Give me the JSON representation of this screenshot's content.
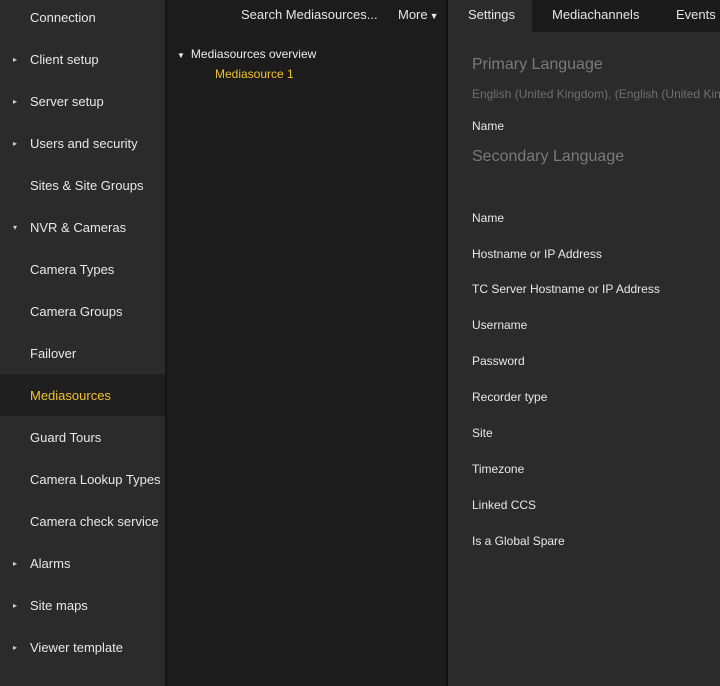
{
  "sidebar": {
    "items": [
      {
        "label": "Connection",
        "arrow": ""
      },
      {
        "label": "Client setup",
        "arrow": "▸"
      },
      {
        "label": "Server setup",
        "arrow": "▸"
      },
      {
        "label": "Users and security",
        "arrow": "▸"
      },
      {
        "label": "Sites & Site Groups",
        "arrow": ""
      },
      {
        "label": "NVR & Cameras",
        "arrow": "▾"
      },
      {
        "label": "Camera Types",
        "arrow": ""
      },
      {
        "label": "Camera Groups",
        "arrow": ""
      },
      {
        "label": "Failover",
        "arrow": ""
      },
      {
        "label": "Mediasources",
        "arrow": "",
        "active": true
      },
      {
        "label": "Guard Tours",
        "arrow": ""
      },
      {
        "label": "Camera Lookup Types",
        "arrow": ""
      },
      {
        "label": "Camera check service",
        "arrow": ""
      },
      {
        "label": "Alarms",
        "arrow": "▸"
      },
      {
        "label": "Site maps",
        "arrow": "▸"
      },
      {
        "label": "Viewer template",
        "arrow": "▸"
      }
    ]
  },
  "middle": {
    "search_label": "Search Mediasources...",
    "more_label": "More",
    "tree": {
      "root_label": "Mediasources overview",
      "child_label": "Mediasource 1"
    }
  },
  "right": {
    "tabs": [
      {
        "label": "Settings",
        "active": true
      },
      {
        "label": "Mediachannels"
      },
      {
        "label": "Events"
      }
    ],
    "primary_language": {
      "heading": "Primary Language",
      "value": "English (United Kingdom), (English (United Kin",
      "name_label": "Name"
    },
    "secondary_language": {
      "heading": "Secondary Language"
    },
    "fields": [
      "Name",
      "Hostname or IP Address",
      "TC Server Hostname or IP Address",
      "Username",
      "Password",
      "Recorder type",
      "Site",
      "Timezone",
      "Linked CCS",
      "Is a Global Spare"
    ]
  },
  "colors": {
    "accent": "#f2c12e",
    "sidebar_bg": "#2b2b2b",
    "panel_bg": "#1c1c1c",
    "heading_gray": "#7a7a7a"
  }
}
